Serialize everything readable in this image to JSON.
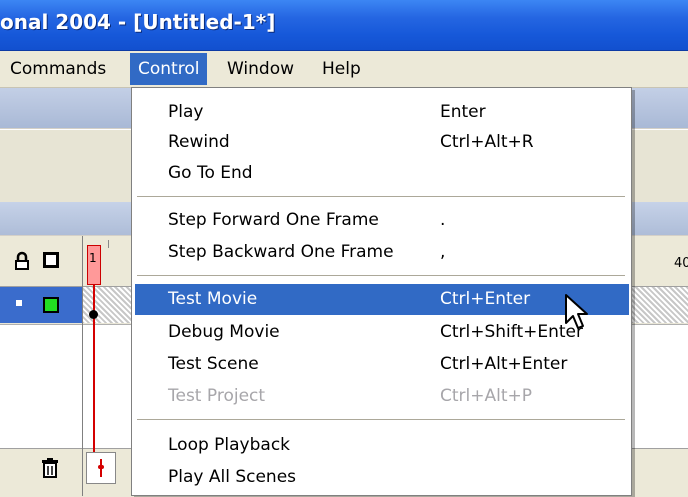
{
  "window": {
    "title": "onal 2004 - [Untitled-1*]"
  },
  "menubar": {
    "items": [
      {
        "label": "Commands",
        "active": false
      },
      {
        "label": "Control",
        "active": true
      },
      {
        "label": "Window",
        "active": false
      },
      {
        "label": "Help",
        "active": false
      }
    ]
  },
  "timeline": {
    "frame_number": "1",
    "ruler_label": "40",
    "icons": [
      "lock-icon",
      "outline-icon",
      "layer-bullet-icon",
      "layer-color-icon",
      "trash-icon",
      "onion-skin-icon"
    ]
  },
  "control_menu": {
    "items": [
      {
        "label": "Play",
        "shortcut": "Enter",
        "state": "normal"
      },
      {
        "label": "Rewind",
        "shortcut": "Ctrl+Alt+R",
        "state": "normal"
      },
      {
        "label": "Go To End",
        "shortcut": "",
        "state": "normal"
      },
      {
        "label": "Step Forward One Frame",
        "shortcut": ".",
        "state": "normal"
      },
      {
        "label": "Step Backward One Frame",
        "shortcut": ",",
        "state": "normal"
      },
      {
        "label": "Test Movie",
        "shortcut": "Ctrl+Enter",
        "state": "highlighted"
      },
      {
        "label": "Debug Movie",
        "shortcut": "Ctrl+Shift+Enter",
        "state": "normal"
      },
      {
        "label": "Test Scene",
        "shortcut": "Ctrl+Alt+Enter",
        "state": "normal"
      },
      {
        "label": "Test Project",
        "shortcut": "Ctrl+Alt+P",
        "state": "disabled"
      },
      {
        "label": "Loop Playback",
        "shortcut": "",
        "state": "normal"
      },
      {
        "label": "Play All Scenes",
        "shortcut": "",
        "state": "normal"
      }
    ]
  },
  "colors": {
    "title_bar": "#2566e2",
    "menu_highlight": "#316ac5",
    "disabled_text": "#a7a6aa",
    "playhead": "#d40000",
    "layer_color": "#22dd22"
  }
}
